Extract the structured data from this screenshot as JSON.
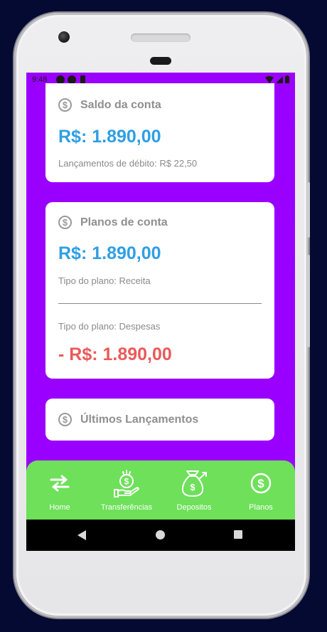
{
  "status_bar": {
    "time": "9:48"
  },
  "balance_card": {
    "title": "Saldo da conta",
    "amount": "R$: 1.890,00",
    "debits": "Lançamentos de débito: R$ 22,50"
  },
  "plans_card": {
    "title": "Planos de conta",
    "income_amount": "R$: 1.890,00",
    "income_type": "Tipo do plano: Receita",
    "expense_type": "Tipo do plano: Despesas",
    "expense_amount": "- R$: 1.890,00"
  },
  "recent_card": {
    "title": "Últimos Lançamentos"
  },
  "bottom_nav": {
    "items": [
      {
        "label": "Home",
        "icon": "transfer-arrows-icon"
      },
      {
        "label": "Transferências",
        "icon": "money-hand-icon"
      },
      {
        "label": "Depositos",
        "icon": "money-bag-icon"
      },
      {
        "label": "Planos",
        "icon": "dollar-circle-icon"
      }
    ]
  },
  "colors": {
    "screen_background": "#9a00ff",
    "accent_blue": "#2f9fe4",
    "expense_red": "#ea5a5a",
    "nav_green": "#6ee05a"
  }
}
